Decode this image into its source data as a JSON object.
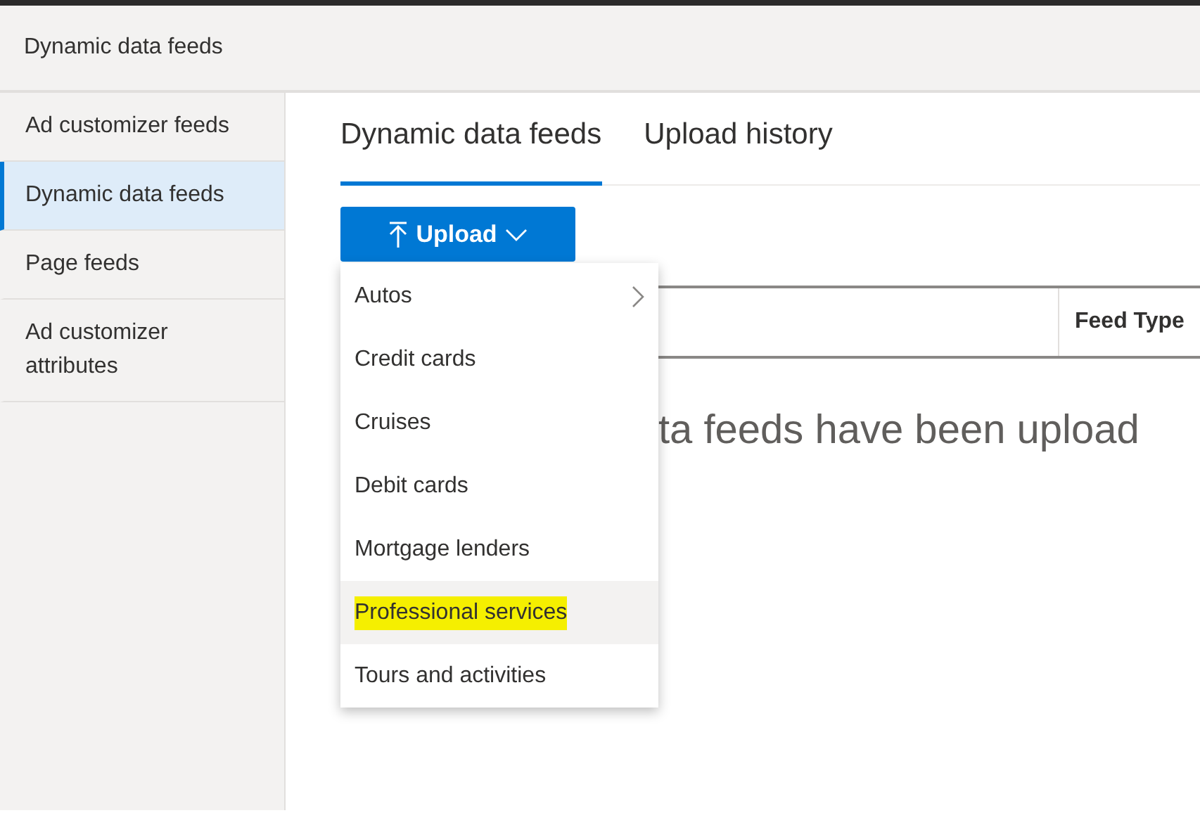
{
  "header": {
    "title": "Dynamic data feeds"
  },
  "sidebar": {
    "items": [
      {
        "label": "Ad customizer feeds",
        "selected": false
      },
      {
        "label": "Dynamic data feeds",
        "selected": true
      },
      {
        "label": "Page feeds",
        "selected": false
      },
      {
        "label": "Ad customizer attributes",
        "selected": false
      }
    ]
  },
  "tabs": [
    {
      "label": "Dynamic data feeds",
      "selected": true
    },
    {
      "label": "Upload history",
      "selected": false
    }
  ],
  "upload_button": {
    "label": "Upload"
  },
  "upload_menu": {
    "items": [
      {
        "label": "Autos",
        "submenu": true,
        "hovered": false,
        "highlighted": false
      },
      {
        "label": "Credit cards",
        "submenu": false,
        "hovered": false,
        "highlighted": false
      },
      {
        "label": "Cruises",
        "submenu": false,
        "hovered": false,
        "highlighted": false
      },
      {
        "label": "Debit cards",
        "submenu": false,
        "hovered": false,
        "highlighted": false
      },
      {
        "label": "Mortgage lenders",
        "submenu": false,
        "hovered": false,
        "highlighted": false
      },
      {
        "label": "Professional services",
        "submenu": false,
        "hovered": true,
        "highlighted": true
      },
      {
        "label": "Tours and activities",
        "submenu": false,
        "hovered": false,
        "highlighted": false
      }
    ]
  },
  "table": {
    "columns": [
      "Feed Type"
    ]
  },
  "empty_message": "ta feeds have been upload"
}
